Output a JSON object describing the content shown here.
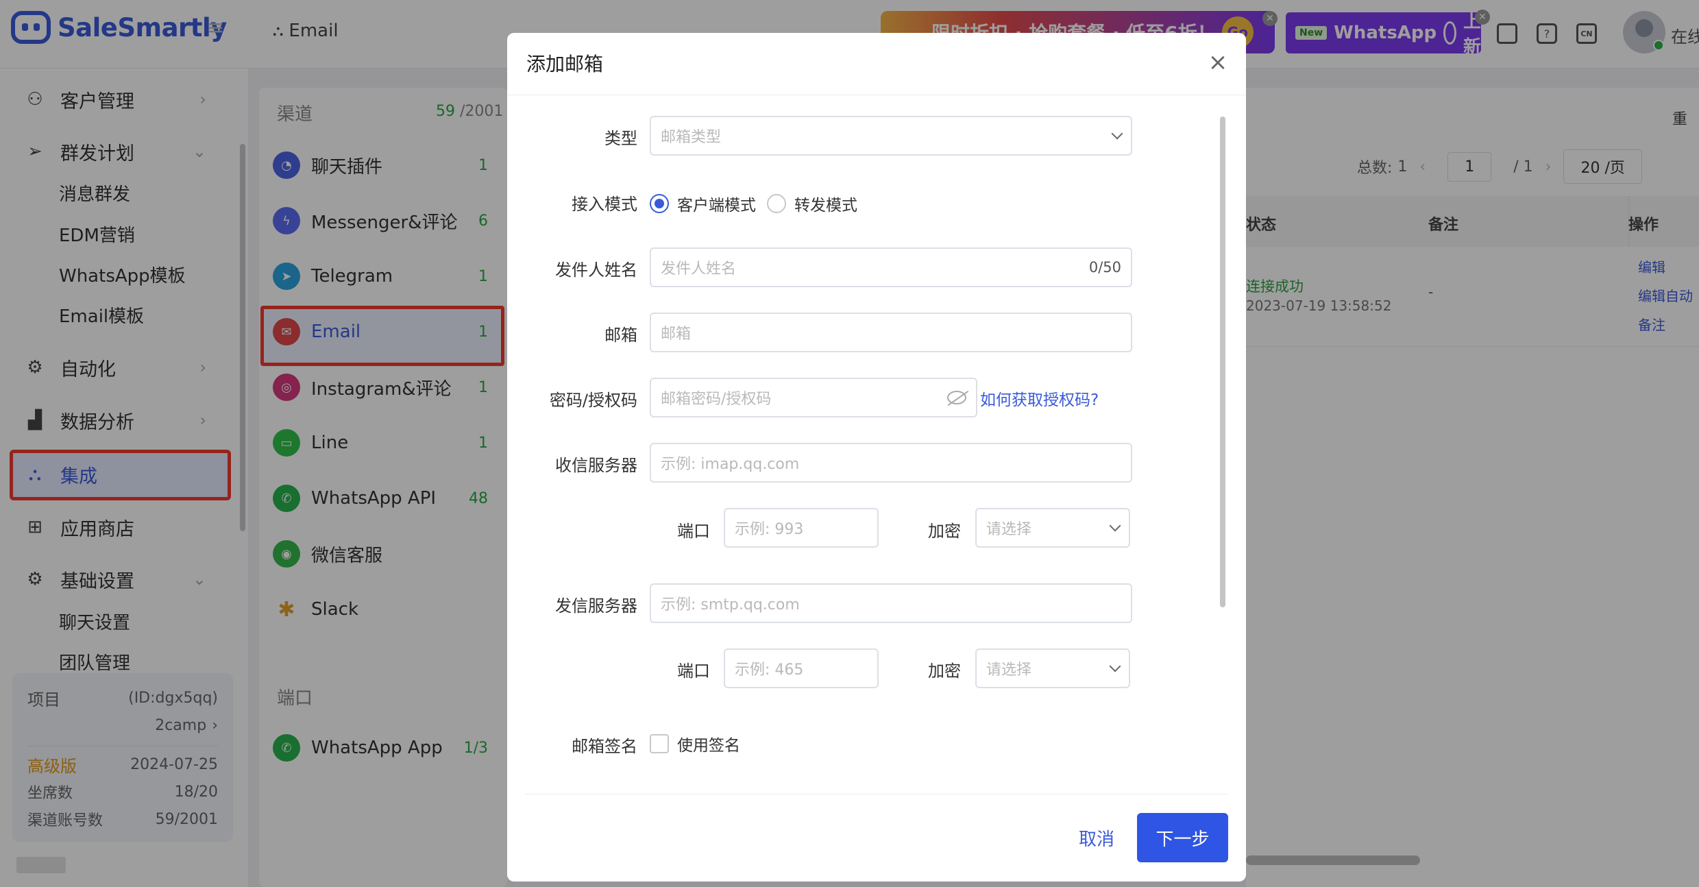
{
  "app": {
    "name": "SaleSmartly"
  },
  "header": {
    "breadcrumb": "Email",
    "promo_text": "限时折扣 · 抢购套餐 · 低至6折！",
    "promo_badge": "Go",
    "wa_new": "New",
    "wa_text": "WhatsApp",
    "wa_suffix": "上新",
    "lang": "CN",
    "status": "在线"
  },
  "sidebar": {
    "items": [
      {
        "label": "客户管理",
        "icon": "users-icon"
      },
      {
        "label": "群发计划",
        "icon": "send-icon"
      },
      {
        "label": "自动化",
        "icon": "robot-icon"
      },
      {
        "label": "数据分析",
        "icon": "chart-icon"
      },
      {
        "label": "集成",
        "icon": "integration-icon"
      },
      {
        "label": "应用商店",
        "icon": "grid-icon"
      },
      {
        "label": "基础设置",
        "icon": "gear-icon"
      }
    ],
    "sub_broadcast": [
      "消息群发",
      "EDM营销",
      "WhatsApp模板",
      "Email模板"
    ],
    "sub_settings": [
      "聊天设置",
      "团队管理"
    ],
    "project": {
      "label": "项目",
      "id": "(ID:dgx5qq)",
      "name": "2camp",
      "plan": "高级版",
      "expiry": "2024-07-25",
      "seats_label": "坐席数",
      "seats": "18/20",
      "accounts_label": "渠道账号数",
      "accounts": "59/2001"
    }
  },
  "channels": {
    "title": "渠道",
    "count_used": "59",
    "count_total": "/2001",
    "items": [
      {
        "label": "聊天插件",
        "count": "1",
        "color": "#4b63e6"
      },
      {
        "label": "Messenger&评论",
        "count": "6",
        "color": "#5b6cf2"
      },
      {
        "label": "Telegram",
        "count": "1",
        "color": "#2aa3dd"
      },
      {
        "label": "Email",
        "count": "1",
        "color": "#e0474c"
      },
      {
        "label": "Instagram&评论",
        "count": "1",
        "color": "#d7377f"
      },
      {
        "label": "Line",
        "count": "1",
        "color": "#2fc24a"
      },
      {
        "label": "WhatsApp API",
        "count": "48",
        "color": "#27b34d"
      },
      {
        "label": "微信客服",
        "count": "",
        "color": "#34b94b"
      },
      {
        "label": "Slack",
        "count": "",
        "color": "#e4a12a"
      }
    ],
    "port_title": "端口",
    "port_items": [
      {
        "label": "WhatsApp App",
        "count": "1/3",
        "color": "#27b34d"
      }
    ]
  },
  "content": {
    "reset": "重",
    "pager": {
      "total_label": "总数:",
      "total": "1",
      "page": "1",
      "pages": "/ 1",
      "size": "20 /页"
    },
    "columns": [
      "状态",
      "备注",
      "操作"
    ],
    "row": {
      "status": "连接成功",
      "time": "2023-07-19 13:58:52",
      "note": "-",
      "actions": [
        "编辑",
        "编辑自动",
        "备注"
      ]
    }
  },
  "modal": {
    "title": "添加邮箱",
    "type_label": "类型",
    "type_placeholder": "邮箱类型",
    "mode_label": "接入模式",
    "mode_client": "客户端模式",
    "mode_forward": "转发模式",
    "sender_label": "发件人姓名",
    "sender_placeholder": "发件人姓名",
    "sender_counter": "0/50",
    "email_label": "邮箱",
    "email_placeholder": "邮箱",
    "password_label": "密码/授权码",
    "password_placeholder": "邮箱密码/授权码",
    "help_link": "如何获取授权码?",
    "imap_label": "收信服务器",
    "imap_placeholder": "示例: imap.qq.com",
    "port_label": "端口",
    "imap_port_placeholder": "示例: 993",
    "encrypt_label": "加密",
    "encrypt_placeholder": "请选择",
    "smtp_label": "发信服务器",
    "smtp_placeholder": "示例: smtp.qq.com",
    "smtp_port_placeholder": "示例: 465",
    "signature_label": "邮箱签名",
    "signature_checkbox": "使用签名",
    "cancel": "取消",
    "next": "下一步"
  }
}
